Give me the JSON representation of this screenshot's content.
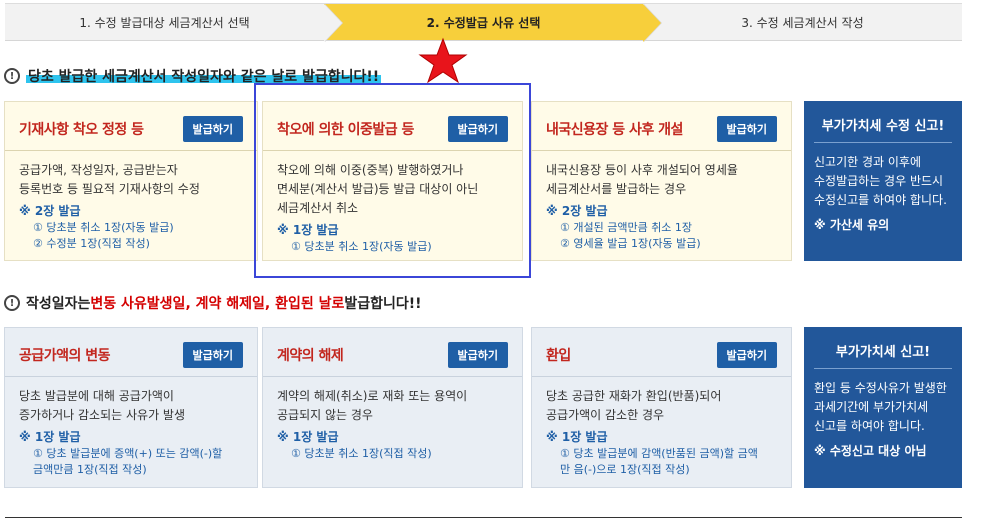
{
  "steps": [
    {
      "label": "1. 수정 발급대상 세금계산서 선택",
      "active": false
    },
    {
      "label": "2. 수정발급 사유 선택",
      "active": true
    },
    {
      "label": "3. 수정 세금계산서 작성",
      "active": false
    }
  ],
  "section1": {
    "icon": "!",
    "text": "당초 발급한 세금계산서 작성일자와 같은 날로 발급합니다!!",
    "cards": [
      {
        "title": "기재사항 착오 정정 등",
        "button": "발급하기",
        "desc": [
          "공급가액, 작성일자, 공급받는자",
          "등록번호 등 필요적 기재사항의 수정"
        ],
        "count": "※ 2장 발급",
        "sub": [
          "① 당초분 취소 1장(자동 발급)",
          "② 수정분 1장(직접 작성)"
        ]
      },
      {
        "title": "착오에 의한 이중발급 등",
        "button": "발급하기",
        "desc": [
          "착오에 의해 이중(중복) 발행하였거나",
          "면세분(계산서 발급)등 발급 대상이 아닌",
          "세금계산서 취소"
        ],
        "count": "※ 1장 발급",
        "sub": [
          "① 당초분 취소 1장(자동 발급)"
        ]
      },
      {
        "title": "내국신용장 등 사후 개설",
        "button": "발급하기",
        "desc": [
          "내국신용장 등이 사후 개설되어 영세율",
          "세금계산서를 발급하는 경우"
        ],
        "count": "※ 2장 발급",
        "sub": [
          "① 개설된 금액만큼 취소 1장",
          "② 영세율 발급 1장(자동 발급)"
        ]
      }
    ],
    "panel": {
      "title": "부가가치세 수정 신고!",
      "text": [
        "신고기한 경과 이후에",
        "수정발급하는 경우 반드시",
        "수정신고를 하여야 합니다."
      ],
      "note": "※ 가산세 유의"
    }
  },
  "section2": {
    "icon": "!",
    "text_parts": [
      {
        "t": "작성일자는 ",
        "red": false
      },
      {
        "t": "변동 사유발생일, 계약 해제일, 환입된 날로",
        "red": true
      },
      {
        "t": " 발급합니다!!",
        "red": false
      }
    ],
    "cards": [
      {
        "title": "공급가액의 변동",
        "button": "발급하기",
        "desc": [
          "당초 발급분에 대해 공급가액이",
          "증가하거나 감소되는 사유가 발생"
        ],
        "count": "※ 1장 발급",
        "sub": [
          "① 당초 발급분에 증액(+) 또는 감액(-)할",
          "금액만큼 1장(직접 작성)"
        ]
      },
      {
        "title": "계약의 해제",
        "button": "발급하기",
        "desc": [
          "계약의 해제(취소)로 재화 또는 용역이",
          "공급되지 않는 경우"
        ],
        "count": "※ 1장 발급",
        "sub": [
          "① 당초분 취소 1장(직접 작성)"
        ]
      },
      {
        "title": "환입",
        "button": "발급하기",
        "desc": [
          "당초 공급한 재화가 환입(반품)되어",
          "공급가액이 감소한 경우"
        ],
        "count": "※ 1장 발급",
        "sub": [
          "① 당초 발급분에 감액(반품된 금액)할 금액",
          "만 음(-)으로 1장(직접 작성)"
        ]
      }
    ],
    "panel": {
      "title": "부가가치세 신고!",
      "text": [
        "환입 등 수정사유가 발생한",
        "과세기간에 부가가치세",
        "신고를 하여야 합니다."
      ],
      "note": "※ 수정신고 대상 아님"
    }
  }
}
